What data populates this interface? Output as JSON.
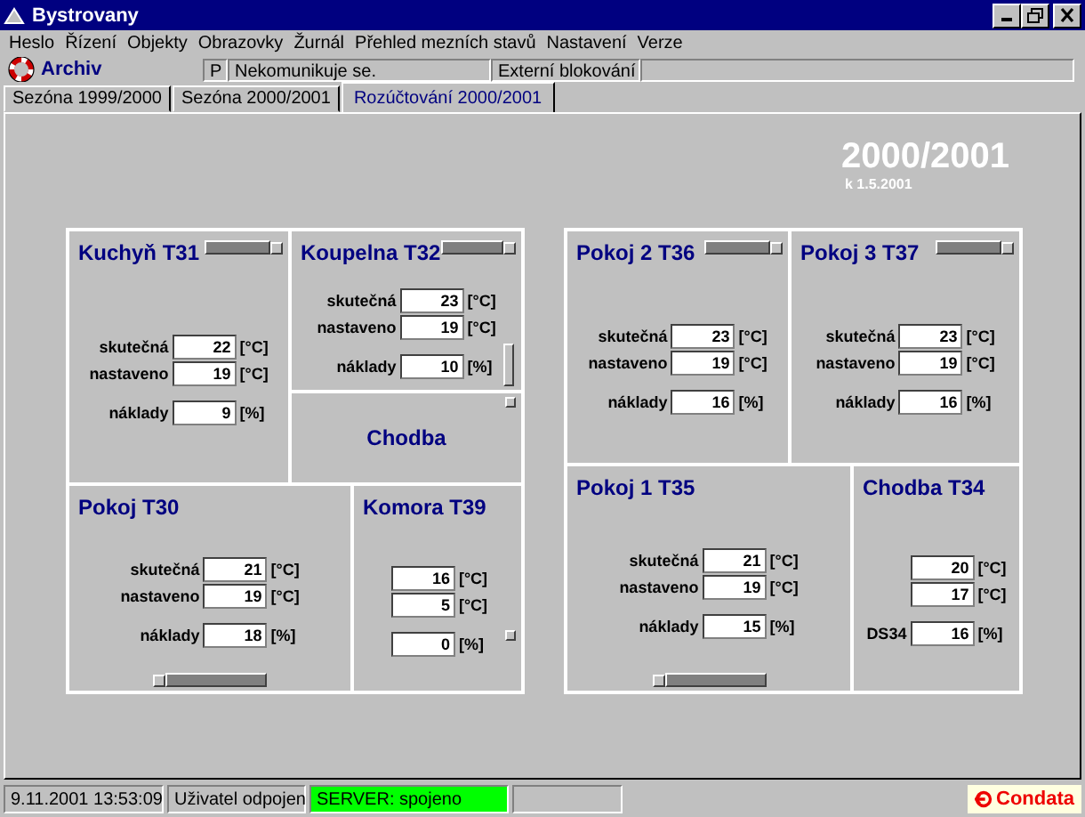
{
  "window": {
    "title": "Bystrovany"
  },
  "menu": [
    "Heslo",
    "Řízení",
    "Objekty",
    "Obrazovky",
    "Žurnál",
    "Přehled mezních stavů",
    "Nastavení",
    "Verze"
  ],
  "toolbar": {
    "archive": "Archiv",
    "indicator": "P",
    "communication": "Nekomunikuje se.",
    "blocking": "Externí blokování"
  },
  "tabs": [
    {
      "label": "Sezóna 1999/2000",
      "selected": false
    },
    {
      "label": "Sezóna 2000/2001",
      "selected": false
    },
    {
      "label": "Rozúčtování 2000/2001",
      "selected": true
    }
  ],
  "header": {
    "season": "2000/2001",
    "date": "k 1.5.2001"
  },
  "blocks": [
    {
      "rooms": [
        {
          "kind": "room",
          "name": "Kuchyň T31",
          "scrollbar": {
            "kind": "top"
          },
          "rows": [
            {
              "label": "skutečná",
              "value": "22",
              "unit": "[°C]"
            },
            {
              "label": "nastaveno",
              "value": "19",
              "unit": "[°C]"
            },
            {
              "label": "náklady",
              "value": "9",
              "unit": "[%]"
            }
          ]
        },
        {
          "kind": "room",
          "name": "Koupelna T32",
          "scrollbar": {
            "kind": "top-side"
          },
          "rows": [
            {
              "label": "skutečná",
              "value": "23",
              "unit": "[°C]"
            },
            {
              "label": "nastaveno",
              "value": "19",
              "unit": "[°C]"
            },
            {
              "label": "náklady",
              "value": "10",
              "unit": "[%]"
            }
          ]
        },
        {
          "kind": "label",
          "name": "Chodba"
        },
        {
          "kind": "room",
          "name": "Pokoj T30",
          "scrollbar": {
            "kind": "bottom"
          },
          "rows": [
            {
              "label": "skutečná",
              "value": "21",
              "unit": "[°C]"
            },
            {
              "label": "nastaveno",
              "value": "19",
              "unit": "[°C]"
            },
            {
              "label": "náklady",
              "value": "18",
              "unit": "[%]"
            }
          ]
        },
        {
          "kind": "room",
          "name": "Komora T39",
          "scrollbar": {
            "kind": "corner"
          },
          "rows": [
            {
              "value": "16",
              "unit": "[°C]"
            },
            {
              "value": "5",
              "unit": "[°C]"
            },
            {
              "value": "0",
              "unit": "[%]"
            }
          ]
        }
      ]
    },
    {
      "rooms": [
        {
          "kind": "room",
          "name": "Pokoj 2 T36",
          "scrollbar": {
            "kind": "top"
          },
          "rows": [
            {
              "label": "skutečná",
              "value": "23",
              "unit": "[°C]"
            },
            {
              "label": "nastaveno",
              "value": "19",
              "unit": "[°C]"
            },
            {
              "label": "náklady",
              "value": "16",
              "unit": "[%]"
            }
          ]
        },
        {
          "kind": "room",
          "name": "Pokoj 3 T37",
          "scrollbar": {
            "kind": "top"
          },
          "rows": [
            {
              "label": "skutečná",
              "value": "23",
              "unit": "[°C]"
            },
            {
              "label": "nastaveno",
              "value": "19",
              "unit": "[°C]"
            },
            {
              "label": "náklady",
              "value": "16",
              "unit": "[%]"
            }
          ]
        },
        {
          "kind": "room",
          "name": "Pokoj 1 T35",
          "scrollbar": {
            "kind": "bottom"
          },
          "rows": [
            {
              "label": "skutečná",
              "value": "21",
              "unit": "[°C]"
            },
            {
              "label": "nastaveno",
              "value": "19",
              "unit": "[°C]"
            },
            {
              "label": "náklady",
              "value": "15",
              "unit": "[%]"
            }
          ]
        },
        {
          "kind": "room",
          "name": "Chodba T34",
          "rows": [
            {
              "value": "20",
              "unit": "[°C]"
            },
            {
              "value": "17",
              "unit": "[°C]"
            },
            {
              "label": "DS34",
              "value": "16",
              "unit": "[%]"
            }
          ]
        }
      ]
    }
  ],
  "status_bar": {
    "datetime": "9.11.2001 13:53:09",
    "user": "Uživatel odpojen",
    "server": "SERVER: spojeno",
    "server_connected": true,
    "brand": "Condata"
  }
}
